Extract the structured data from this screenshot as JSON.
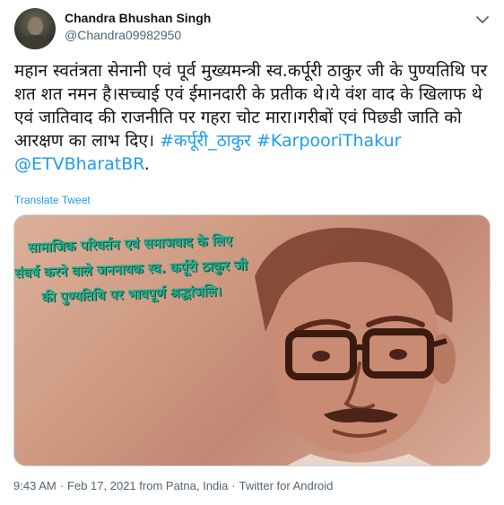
{
  "user": {
    "display_name": "Chandra Bhushan Singh",
    "handle": "@Chandra09982950"
  },
  "tweet": {
    "text": "महान स्वतंत्रता सेनानी एवं पूर्व मुख्यमन्त्री स्व.कर्पूरी ठाकुर जी के पुण्यतिथि पर शत शत नमन है।सच्चाई एवं ईमानदारी के प्रतीक थे।ये वंश वाद के खिलाफ थे एवं जातिवाद की राजनीति पर गहरा चोट मारा।गरीबों एवं पिछडी जाति को आरक्षण का लाभ दिए।",
    "hashtags": [
      "#कर्पूरी_ठाकुर",
      "#KarpooriThakur"
    ],
    "mention": "@ETVBharatBR",
    "trailing": ".",
    "translate_label": "Translate Tweet"
  },
  "media": {
    "caption": "सामाजिक परिवर्तन एवं समाजवाद के लिए संघर्ष करने वाले जननायक स्व. कर्पूरी ठाकुर जी की पुण्यतिथि पर भावपूर्ण श्रद्धांजलि।"
  },
  "footer": {
    "time": "9:43 AM",
    "date": "Feb 17, 2021",
    "location": "from Patna, India",
    "source": "Twitter for Android"
  },
  "colors": {
    "link": "#1d9bf0",
    "text": "#0f1419",
    "muted": "#536471",
    "caption": "#1fae8c"
  },
  "icons": {
    "more": "chevron-down-icon"
  }
}
